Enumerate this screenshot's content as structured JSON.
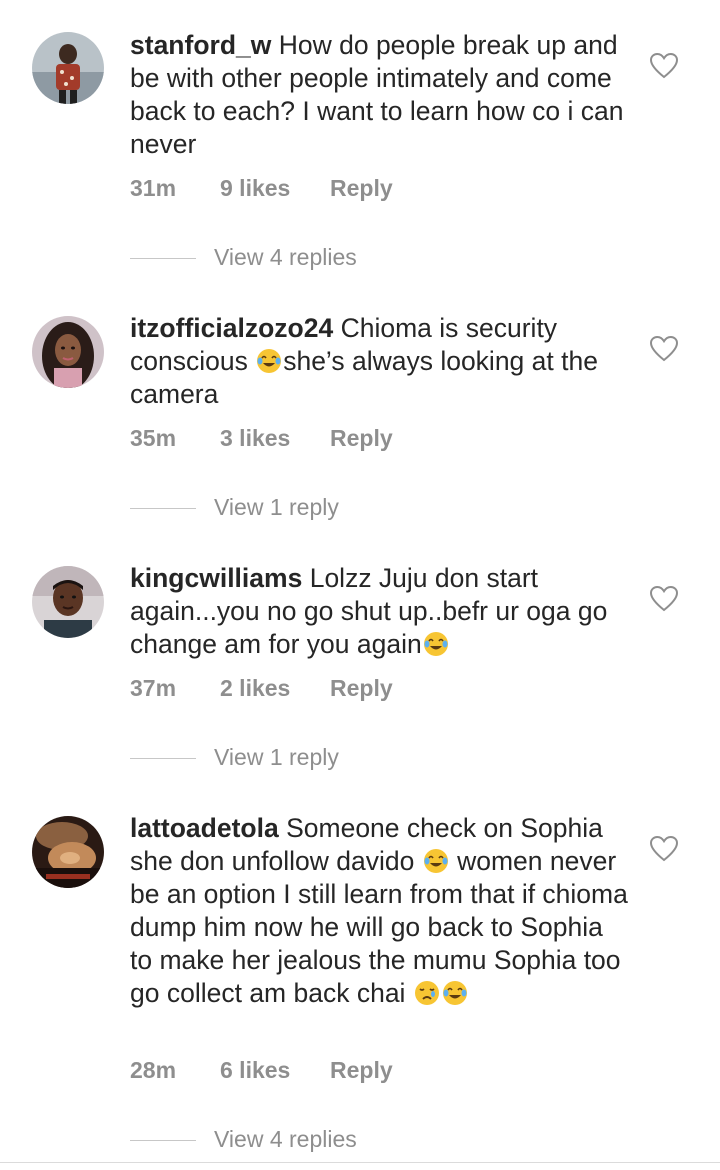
{
  "comments": [
    {
      "username": "stanford_w",
      "text": "How do people break up and be with other people intimately and come back to each? I want to learn how co i can never",
      "time": "31m",
      "likes": "9 likes",
      "reply": "Reply",
      "view_replies": "View 4 replies"
    },
    {
      "username": "itzofficialzozo24",
      "text_before": "Chioma is security conscious ",
      "text_after": "she’s always looking at the camera",
      "time": "35m",
      "likes": "3 likes",
      "reply": "Reply",
      "view_replies": "View 1 reply"
    },
    {
      "username": "kingcwilliams",
      "text": "Lolzz Juju don start again...you no go shut up..befr ur oga go change am for you again",
      "time": "37m",
      "likes": "2 likes",
      "reply": "Reply",
      "view_replies": "View 1 reply"
    },
    {
      "username": "lattoadetola",
      "text_before": "Someone check on Sophia she don unfollow davido ",
      "text_after": " women never be an option I still learn from that if chioma dump him now he will go back to Sophia to make her jealous the mumu Sophia too go collect am back chai ",
      "time": "28m",
      "likes": "6 likes",
      "reply": "Reply",
      "view_replies": "View 4 replies"
    }
  ],
  "icons": {
    "like": "heart-outline-icon",
    "laugh_emoji": "face-with-tears-of-joy-emoji",
    "cry_emoji": "crying-face-emoji"
  },
  "colors": {
    "text": "#262626",
    "secondary": "#8e8e8e",
    "emoji_yellow": "#f7c533"
  }
}
